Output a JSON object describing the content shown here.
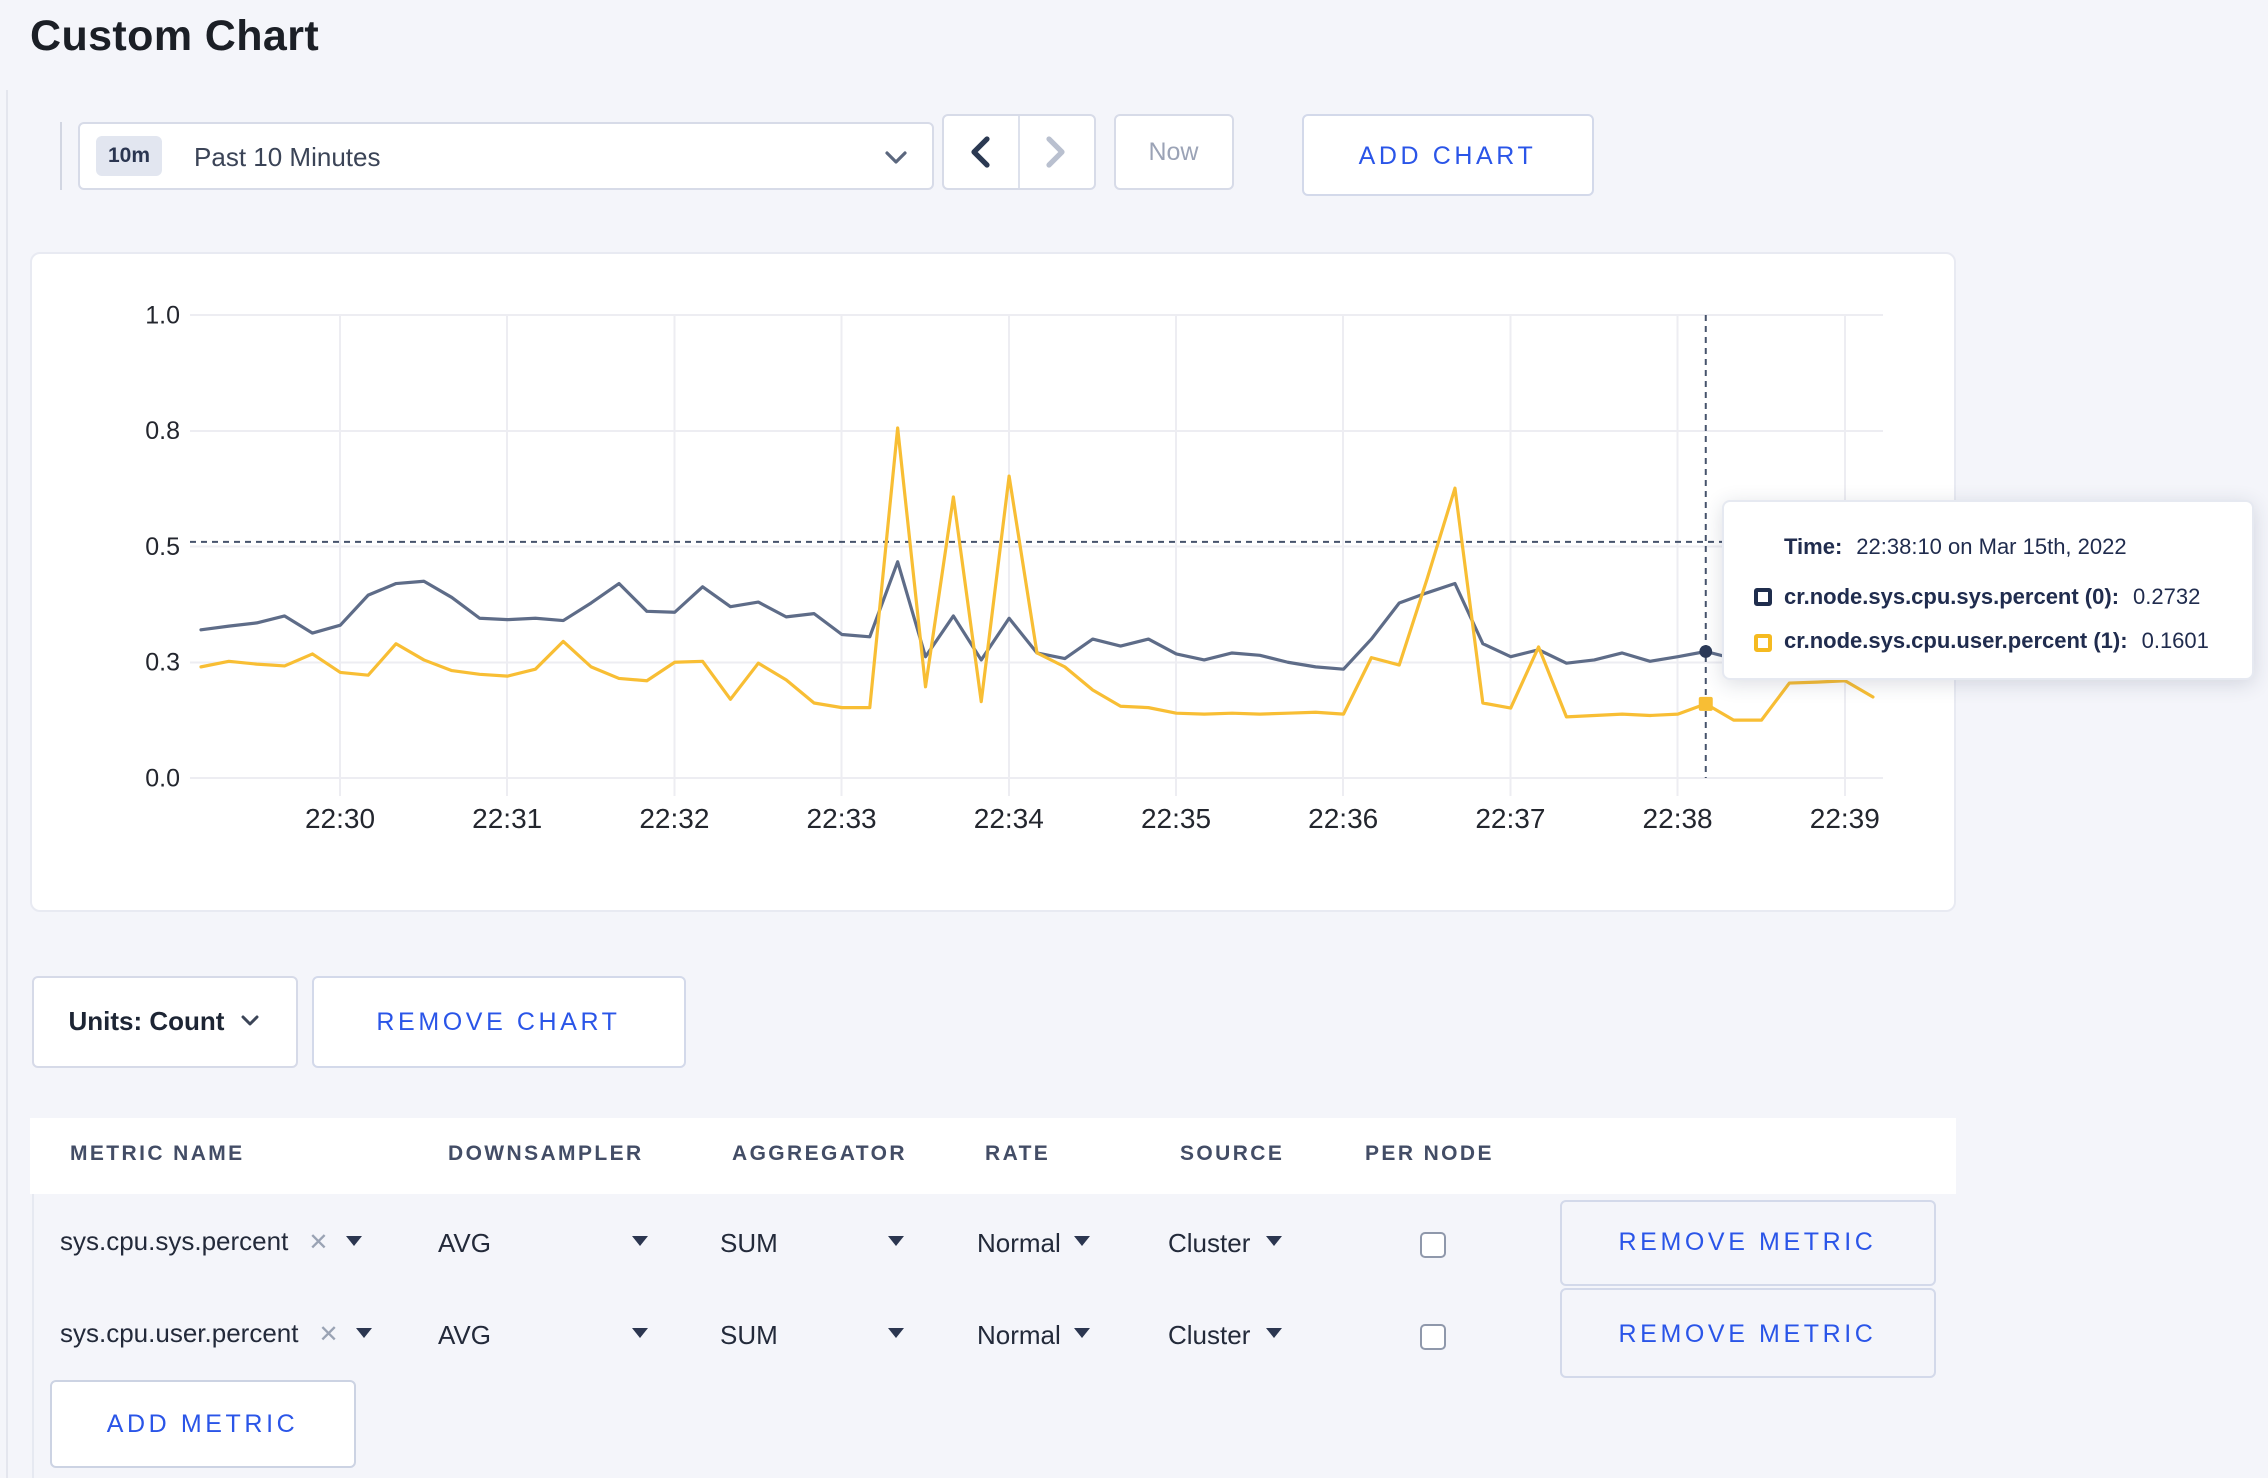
{
  "page": {
    "title": "Custom Chart"
  },
  "toolbar": {
    "range_badge": "10m",
    "range_label": "Past 10 Minutes",
    "now_label": "Now",
    "add_chart_label": "ADD CHART"
  },
  "chart_data": {
    "type": "line",
    "title": "",
    "xlabel": "",
    "ylabel": "",
    "ylim": [
      0,
      1
    ],
    "grid": true,
    "x_tick_labels": [
      "22:30",
      "22:31",
      "22:32",
      "22:33",
      "22:34",
      "22:35",
      "22:36",
      "22:37",
      "22:38",
      "22:39"
    ],
    "y_tick_labels": [
      "0.0",
      "0.3",
      "0.5",
      "0.8",
      "1.0"
    ],
    "y_tick_values": [
      0,
      0.25,
      0.5,
      0.75,
      1.0
    ],
    "x_start_time": "22:29:10",
    "x_interval_seconds": 10,
    "series": [
      {
        "name": "cr.node.sys.cpu.sys.percent (0)",
        "color": "#5e6c88",
        "values": [
          0.32,
          0.328,
          0.335,
          0.35,
          0.313,
          0.33,
          0.395,
          0.42,
          0.425,
          0.39,
          0.345,
          0.342,
          0.345,
          0.34,
          0.378,
          0.42,
          0.36,
          0.358,
          0.413,
          0.37,
          0.38,
          0.348,
          0.355,
          0.31,
          0.305,
          0.467,
          0.262,
          0.35,
          0.255,
          0.345,
          0.27,
          0.258,
          0.3,
          0.285,
          0.3,
          0.268,
          0.255,
          0.27,
          0.265,
          0.25,
          0.24,
          0.235,
          0.3,
          0.378,
          0.4,
          0.42,
          0.29,
          0.262,
          0.277,
          0.248,
          0.255,
          0.27,
          0.252,
          0.262,
          0.2732,
          0.258,
          0.248,
          0.265,
          0.285,
          0.3,
          0.295
        ]
      },
      {
        "name": "cr.node.sys.cpu.user.percent (1)",
        "color": "#f8be34",
        "values": [
          0.24,
          0.252,
          0.246,
          0.242,
          0.268,
          0.228,
          0.222,
          0.29,
          0.255,
          0.232,
          0.224,
          0.22,
          0.235,
          0.295,
          0.24,
          0.215,
          0.21,
          0.25,
          0.252,
          0.17,
          0.248,
          0.212,
          0.162,
          0.152,
          0.152,
          0.756,
          0.197,
          0.607,
          0.165,
          0.652,
          0.27,
          0.24,
          0.19,
          0.155,
          0.152,
          0.14,
          0.138,
          0.14,
          0.138,
          0.14,
          0.142,
          0.138,
          0.26,
          0.244,
          0.43,
          0.626,
          0.162,
          0.151,
          0.283,
          0.132,
          0.135,
          0.138,
          0.135,
          0.138,
          0.1601,
          0.125,
          0.125,
          0.205,
          0.207,
          0.21,
          0.175
        ]
      }
    ],
    "hover": {
      "index": 54,
      "crosshair_y_value": 0.51
    }
  },
  "tooltip": {
    "time_prefix": "Time:",
    "time": "22:38:10 on Mar 15th, 2022",
    "rows": [
      {
        "label": "cr.node.sys.cpu.sys.percent (0):",
        "value": "0.2732",
        "color": "#1f2d4d"
      },
      {
        "label": "cr.node.sys.cpu.user.percent (1):",
        "value": "0.1601",
        "color": "#f5ba20"
      }
    ]
  },
  "units_bar": {
    "units_label": "Units: Count",
    "remove_chart_label": "REMOVE CHART"
  },
  "metrics_table": {
    "headers": [
      "METRIC NAME",
      "DOWNSAMPLER",
      "AGGREGATOR",
      "RATE",
      "SOURCE",
      "PER NODE"
    ],
    "rows": [
      {
        "metric": "sys.cpu.sys.percent",
        "downsampler": "AVG",
        "aggregator": "SUM",
        "rate": "Normal",
        "source": "Cluster",
        "per_node_checked": false,
        "remove_label": "REMOVE METRIC"
      },
      {
        "metric": "sys.cpu.user.percent",
        "downsampler": "AVG",
        "aggregator": "SUM",
        "rate": "Normal",
        "source": "Cluster",
        "per_node_checked": false,
        "remove_label": "REMOVE METRIC"
      }
    ],
    "add_metric_label": "ADD METRIC"
  }
}
